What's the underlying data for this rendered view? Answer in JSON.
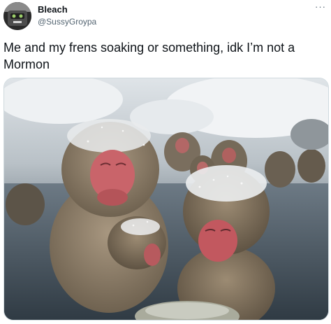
{
  "tweet": {
    "author": {
      "display_name": "Bleach",
      "handle": "@SussyGroypa",
      "avatar_icon": "avatar-image"
    },
    "more_icon": "more-options-icon",
    "more_label": "···",
    "text": "Me and my frens soaking or something, idk I’m not a Mormon",
    "media": {
      "icon": "photo-snow-monkeys",
      "scene": "snow monkeys in hot spring"
    }
  },
  "colors": {
    "text_primary": "#0f1419",
    "text_secondary": "#536471",
    "border": "#cfd9de"
  }
}
